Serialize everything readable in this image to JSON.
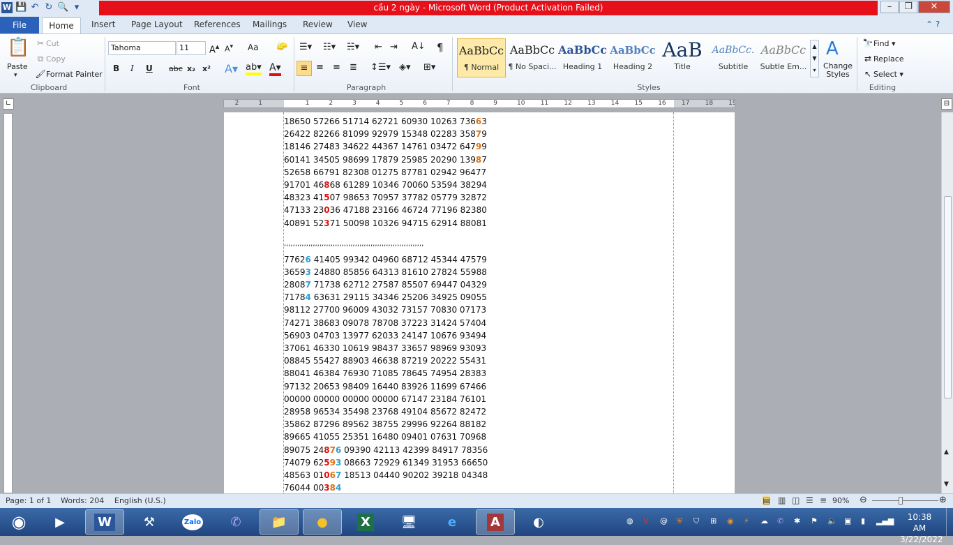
{
  "window": {
    "title": "cầu 2 ngày  -  Microsoft Word (Product Activation Failed)"
  },
  "tabs": [
    "File",
    "Home",
    "Insert",
    "Page Layout",
    "References",
    "Mailings",
    "Review",
    "View"
  ],
  "clipboard": {
    "paste": "Paste",
    "cut": "Cut",
    "copy": "Copy",
    "format_painter": "Format Painter",
    "label": "Clipboard"
  },
  "font": {
    "name": "Tahoma",
    "size": "11",
    "label": "Font",
    "bold": "B",
    "italic": "I",
    "underline": "U",
    "strike": "abc",
    "sub": "x₂",
    "sup": "x²",
    "grow": "A",
    "change_case": "Aa"
  },
  "paragraph": {
    "label": "Paragraph"
  },
  "styles": {
    "label": "Styles",
    "items": [
      {
        "preview": "AaBbCc",
        "name": "¶ Normal"
      },
      {
        "preview": "AaBbCc",
        "name": "¶ No Spaci..."
      },
      {
        "preview": "AaBbCc",
        "name": "Heading 1"
      },
      {
        "preview": "AaBbCc",
        "name": "Heading 2"
      },
      {
        "preview": "AaB",
        "name": "Title"
      },
      {
        "preview": "AaBbCc.",
        "name": "Subtitle"
      },
      {
        "preview": "AaBbCc",
        "name": "Subtle Em..."
      }
    ],
    "change_styles": "Change Styles"
  },
  "editing": {
    "find": "Find",
    "replace": "Replace",
    "select": "Select",
    "label": "Editing"
  },
  "document": {
    "block1": [
      [
        [
          "18650 57266 51714 62721 60930 10263 736",
          ""
        ],
        [
          "6",
          "o"
        ],
        [
          "3",
          ""
        ]
      ],
      [
        [
          "26422 82266 81099 92979 15348 02283 358",
          ""
        ],
        [
          "7",
          "o"
        ],
        [
          "9",
          ""
        ]
      ],
      [
        [
          "18146 27483 34622 44367 14761 03472 647",
          ""
        ],
        [
          "9",
          "o"
        ],
        [
          "9",
          ""
        ]
      ],
      [
        [
          "60141 34505 98699 17879 25985 20290 139",
          ""
        ],
        [
          "8",
          "o"
        ],
        [
          "7",
          ""
        ]
      ],
      [
        [
          "52658 66791 82308 01275 87781 02942 96477",
          ""
        ]
      ],
      [
        [
          "91701 46",
          ""
        ],
        [
          "8",
          "r"
        ],
        [
          "68 61289 10346 70060 53594 38294",
          ""
        ]
      ],
      [
        [
          "48323 41",
          ""
        ],
        [
          "5",
          "r"
        ],
        [
          "07 98653 70957 37782 05779 32872",
          ""
        ]
      ],
      [
        [
          "47133 23",
          ""
        ],
        [
          "0",
          "r"
        ],
        [
          "36 47188 23166 46724 77196 82380",
          ""
        ]
      ],
      [
        [
          "40891 52",
          ""
        ],
        [
          "3",
          "r"
        ],
        [
          "71 50098 10326 94715 62914 88081",
          ""
        ]
      ]
    ],
    "separator": ",,,,,,,,,,,,,,,,,,,,,,,,,,,,,,,,,,,,,,,,,,,,,,,,,,,,,,,,,,,,,,,",
    "block2": [
      [
        [
          "7762",
          ""
        ],
        [
          "6",
          "b"
        ],
        [
          " 41405 99342 04960 68712 45344 47579",
          ""
        ]
      ],
      [
        [
          "3659",
          ""
        ],
        [
          "3",
          "b"
        ],
        [
          " 24880 85856 64313 81610 27824 55988",
          ""
        ]
      ],
      [
        [
          "2808",
          ""
        ],
        [
          "7",
          "b"
        ],
        [
          " 71738 62712 27587 85507 69447 04329",
          ""
        ]
      ],
      [
        [
          "7178",
          ""
        ],
        [
          "4",
          "b"
        ],
        [
          " 63631 29115 34346 25206 34925 09055",
          ""
        ]
      ],
      [
        [
          "98112 27700 96009 43032 73157 70830 07173",
          ""
        ]
      ],
      [
        [
          "74271 38683 09078 78708 37223 31424 57404",
          ""
        ]
      ],
      [
        [
          "56903 04703 13977 62033 24147 10676 93494",
          ""
        ]
      ],
      [
        [
          "37061 46330 10619 98437 33657 98969 93093",
          ""
        ]
      ],
      [
        [
          "08845 55427 88903 46638 87219 20222 55431",
          ""
        ]
      ],
      [
        [
          "88041 46384 76930 71085 78645 74954 28383",
          ""
        ]
      ],
      [
        [
          "97132 20653 98409 16440 83926 11699 67466",
          ""
        ]
      ],
      [
        [
          "00000 00000 00000 00000 67147 23184 76101",
          ""
        ]
      ],
      [
        [
          "28958 96534 35498 23768 49104 85672 82472",
          ""
        ]
      ],
      [
        [
          "35862 87296 89562 38755 29996 92264 88182",
          ""
        ]
      ],
      [
        [
          "89665 41055 25351 16480 09401 07631 70968",
          ""
        ]
      ],
      [
        [
          "89075 24",
          ""
        ],
        [
          "8",
          "r"
        ],
        [
          "7",
          "o"
        ],
        [
          "6",
          "b"
        ],
        [
          " 09390 42113 42399 84917 78356",
          ""
        ]
      ],
      [
        [
          "74079 62",
          ""
        ],
        [
          "5",
          "r"
        ],
        [
          "9",
          "o"
        ],
        [
          "3",
          "b"
        ],
        [
          " 08663 72929 61349 31953 66650",
          ""
        ]
      ],
      [
        [
          "48563 01",
          ""
        ],
        [
          "0",
          "r"
        ],
        [
          "6",
          "o"
        ],
        [
          "7",
          "b"
        ],
        [
          " 18513 04440 90202 39218 04348",
          ""
        ]
      ],
      [
        [
          "76044 00",
          ""
        ],
        [
          "3",
          "r"
        ],
        [
          "8",
          "o"
        ],
        [
          "4",
          "b"
        ]
      ]
    ]
  },
  "status": {
    "page": "Page: 1 of 1",
    "words": "Words: 204",
    "lang": "English (U.S.)",
    "zoom": "90%"
  },
  "clock": {
    "time": "10:38 AM",
    "date": "3/22/2022"
  },
  "taskbar_apps": [
    "start-orb",
    "media-player",
    "word",
    "dt-app",
    "zalo",
    "viber",
    "file-explorer",
    "chrome",
    "excel",
    "remote-desktop",
    "internet-explorer",
    "access",
    "edge-like"
  ]
}
